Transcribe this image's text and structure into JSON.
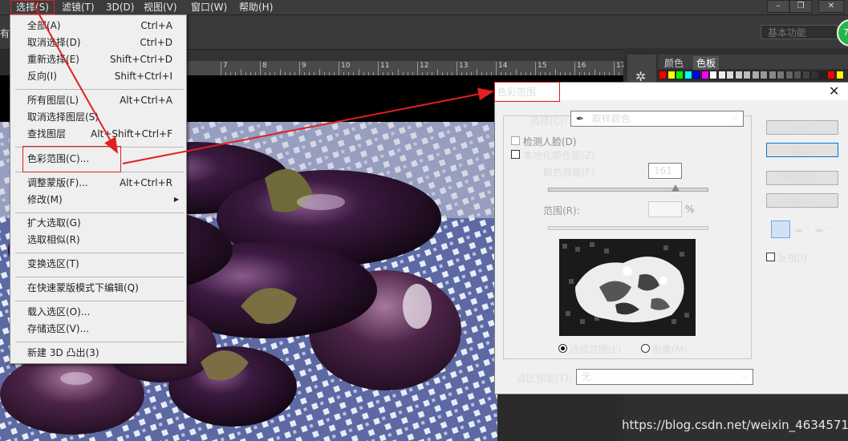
{
  "menubar": {
    "items": [
      "选择(S)",
      "滤镜(T)",
      "3D(D)",
      "视图(V)",
      "窗口(W)",
      "帮助(H)"
    ],
    "window_buttons": [
      "–",
      "❐",
      "✕"
    ]
  },
  "options_bar": {
    "left_label": "有",
    "workspace": "基本功能"
  },
  "avatar": {
    "text": "7"
  },
  "ruler": {
    "ticks": [
      "7",
      "8",
      "9",
      "10",
      "11",
      "12",
      "13",
      "14",
      "15",
      "16",
      "17"
    ]
  },
  "select_menu": {
    "items": [
      {
        "label": "全部(A)",
        "shortcut": "Ctrl+A",
        "disabled": false
      },
      {
        "label": "取消选择(D)",
        "shortcut": "Ctrl+D",
        "disabled": false
      },
      {
        "label": "重新选择(E)",
        "shortcut": "Shift+Ctrl+D",
        "disabled": false
      },
      {
        "label": "反向(I)",
        "shortcut": "Shift+Ctrl+I",
        "disabled": false
      },
      {
        "label": "所有图层(L)",
        "shortcut": "Alt+Ctrl+A",
        "disabled": false
      },
      {
        "label": "取消选择图层(S)",
        "shortcut": "",
        "disabled": false
      },
      {
        "label": "查找图层",
        "shortcut": "Alt+Shift+Ctrl+F",
        "disabled": false
      },
      {
        "label": "色彩范围(C)...",
        "shortcut": "",
        "disabled": false
      },
      {
        "label": "调整蒙版(F)...",
        "shortcut": "Alt+Ctrl+R",
        "disabled": false
      },
      {
        "label": "修改(M)",
        "shortcut": "",
        "disabled": false
      },
      {
        "label": "扩大选取(G)",
        "shortcut": "",
        "disabled": false
      },
      {
        "label": "选取相似(R)",
        "shortcut": "",
        "disabled": false
      },
      {
        "label": "变换选区(T)",
        "shortcut": "",
        "disabled": false
      },
      {
        "label": "在快速蒙版模式下编辑(Q)",
        "shortcut": "",
        "disabled": false
      },
      {
        "label": "载入选区(O)...",
        "shortcut": "",
        "disabled": false
      },
      {
        "label": "存储选区(V)...",
        "shortcut": "",
        "disabled": false
      },
      {
        "label": "新建 3D 凸出(3)",
        "shortcut": "",
        "disabled": false
      }
    ]
  },
  "dialog": {
    "title": "色彩范围",
    "select_label": "选择(C):",
    "select_value": "取样颜色",
    "detect_faces": "检测人脸(D)",
    "localized": "本地化颜色簇(Z)",
    "fuzziness_label": "颜色容差(F):",
    "fuzziness_value": "161",
    "range_label": "范围(R):",
    "range_unit": "%",
    "radio_selection": "选择范围(E)",
    "radio_image": "图像(M)",
    "preview_label": "选区预览(T):",
    "preview_value": "无",
    "ok": "确定",
    "cancel": "取消",
    "load": "载入(L)...",
    "save": "存储(S)...",
    "invert": "反相(I)",
    "close": "✕"
  },
  "right_panel": {
    "tabs": [
      "颜色",
      "色板"
    ],
    "swatch_colors": [
      "#ff0000",
      "#ffff00",
      "#00ff00",
      "#00ffff",
      "#0000ff",
      "#ff00ff",
      "#ffffff",
      "#eeeeee",
      "#dddddd",
      "#cccccc",
      "#bbbbbb",
      "#aaaaaa",
      "#999999",
      "#888888",
      "#777777",
      "#666666",
      "#555555",
      "#444444",
      "#333333",
      "#222222",
      "#ff0000",
      "#ffff00"
    ]
  },
  "watermark": "https://blog.csdn.net/weixin_46345713",
  "colors": {
    "annotation": "#e02020",
    "menu_bg": "#efefef",
    "dialog_bg": "#f0f0f0",
    "app_bg": "#2b2b2b"
  }
}
